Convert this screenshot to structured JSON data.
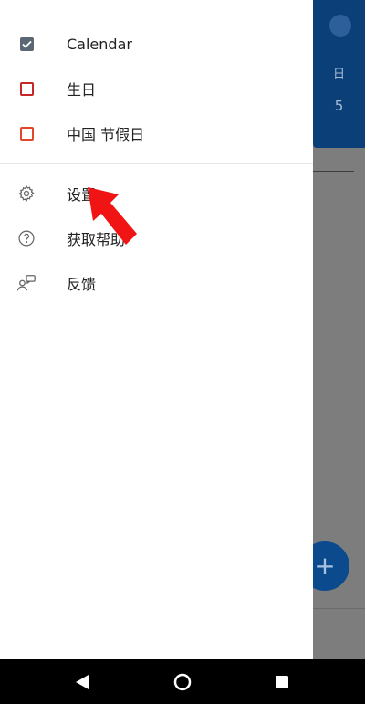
{
  "background": {
    "day_label": "日",
    "day_number": "5",
    "fab_symbol": "+",
    "header_color": "#0b3f78"
  },
  "drawer": {
    "calendars": [
      {
        "label": "Calendar",
        "checked": true,
        "color": "#5a6876"
      },
      {
        "label": "生日",
        "checked": false,
        "color": "#c62828"
      },
      {
        "label": "中国 节假日",
        "checked": false,
        "color": "#e0472b"
      }
    ],
    "menu": [
      {
        "label": "设置",
        "icon": "gear-icon"
      },
      {
        "label": "获取帮助",
        "icon": "help-circle-icon"
      },
      {
        "label": "反馈",
        "icon": "feedback-icon"
      }
    ]
  },
  "annotation": {
    "color": "#f01414",
    "icon": "red-arrow-pointer"
  },
  "navbar": {
    "back": "back-triangle-icon",
    "home": "home-circle-icon",
    "recents": "recents-square-icon"
  }
}
